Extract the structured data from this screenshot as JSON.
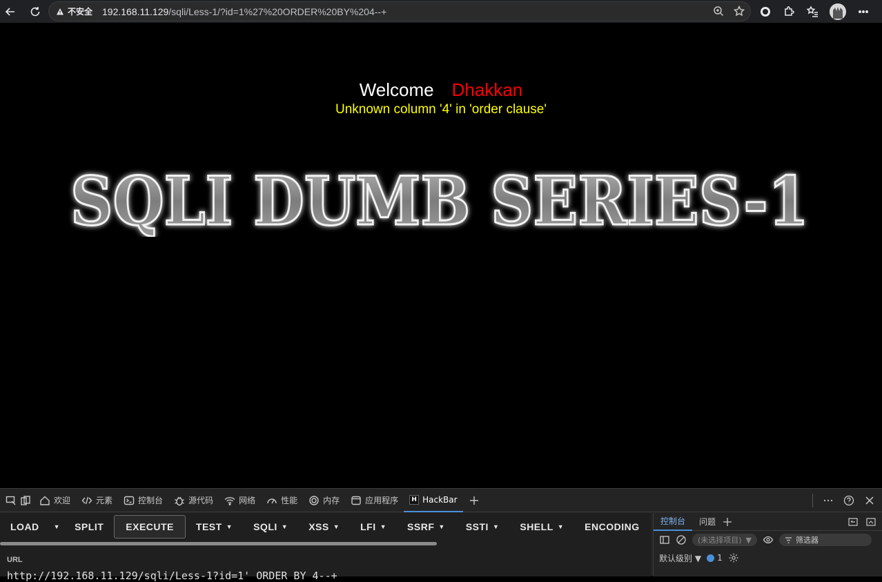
{
  "browser": {
    "security_label": "不安全",
    "url_host": "192.168.11.129",
    "url_path": "/sqli/Less-1/?id=1%27%20ORDER%20BY%204--+"
  },
  "page": {
    "welcome": "Welcome",
    "username": "Dhakkan",
    "error": "Unknown column '4' in 'order clause'",
    "banner": "SQLI DUMB SERIES-1"
  },
  "devtools": {
    "tabs": [
      "欢迎",
      "元素",
      "控制台",
      "源代码",
      "网络",
      "性能",
      "内存",
      "应用程序",
      "HackBar"
    ],
    "active_tab": "HackBar"
  },
  "hackbar": {
    "menu": [
      {
        "label": "LOAD",
        "dropdown": false
      },
      {
        "label": "SPLIT",
        "dropdown": false
      },
      {
        "label": "EXECUTE",
        "dropdown": false
      },
      {
        "label": "TEST",
        "dropdown": true
      },
      {
        "label": "SQLI",
        "dropdown": true
      },
      {
        "label": "XSS",
        "dropdown": true
      },
      {
        "label": "LFI",
        "dropdown": true
      },
      {
        "label": "SSRF",
        "dropdown": true
      },
      {
        "label": "SSTI",
        "dropdown": true
      },
      {
        "label": "SHELL",
        "dropdown": true
      },
      {
        "label": "ENCODING",
        "dropdown": false
      }
    ],
    "url_label": "URL",
    "url_value": "http://192.168.11.129/sqli/Less-1?id=1' ORDER BY 4--+"
  },
  "console_drawer": {
    "tabs": [
      "控制台",
      "问题"
    ],
    "context_placeholder": "(未选择项目)",
    "filter_placeholder": "筛选器",
    "level_label": "默认级别",
    "message_count": "1"
  }
}
